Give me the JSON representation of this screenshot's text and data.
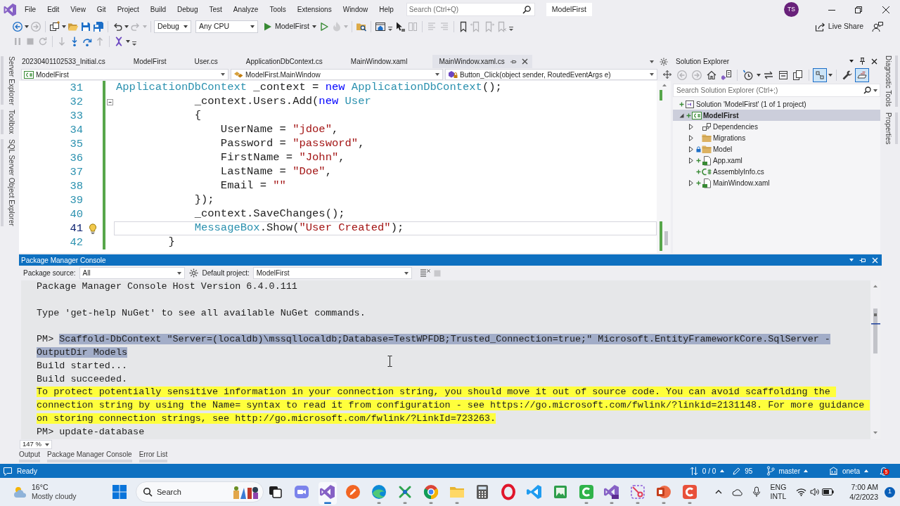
{
  "title_bar": {
    "menu": [
      "File",
      "Edit",
      "View",
      "Git",
      "Project",
      "Build",
      "Debug",
      "Test",
      "Analyze",
      "Tools",
      "Extensions",
      "Window",
      "Help"
    ],
    "search": {
      "placeholder": "Search (Ctrl+Q)"
    },
    "solution_name": "ModelFirst",
    "account_initials": "TS"
  },
  "toolbar": [
    {
      "kind": "back",
      "disabled": false
    },
    {
      "kind": "forward",
      "disabled": true
    },
    {
      "kind": "new-project",
      "disabled": false
    },
    {
      "kind": "open",
      "disabled": false
    },
    {
      "kind": "save",
      "disabled": false
    },
    {
      "kind": "save-all",
      "disabled": false
    },
    {
      "kind": "undo",
      "disabled": false
    },
    {
      "kind": "redo",
      "disabled": true
    },
    {
      "kind": "configuration",
      "value": "Debug",
      "disabled": false
    },
    {
      "kind": "platform",
      "value": "Any CPU",
      "disabled": false
    },
    {
      "kind": "start",
      "label": "ModelFirst",
      "disabled": false
    },
    {
      "kind": "start-without-debugging",
      "disabled": false
    },
    {
      "kind": "hot-reload",
      "disabled": true
    },
    {
      "kind": "find-in-folder",
      "disabled": false
    },
    {
      "kind": "browse",
      "disabled": false
    },
    {
      "kind": "overflow",
      "disabled": false
    },
    {
      "kind": "pointer",
      "disabled": false
    },
    {
      "kind": "layout",
      "disabled": true
    },
    {
      "kind": "comment",
      "disabled": true
    },
    {
      "kind": "uncomment",
      "disabled": true
    },
    {
      "kind": "bookmark",
      "disabled": false
    },
    {
      "kind": "bookmark-previous",
      "disabled": true
    },
    {
      "kind": "bookmark-next",
      "disabled": true
    },
    {
      "kind": "bookmark-clear",
      "disabled": true
    },
    {
      "kind": "overflow",
      "disabled": false
    }
  ],
  "live_share": {
    "label": "Live Share"
  },
  "debug_toolbar": [
    {
      "kind": "pause",
      "disabled": true
    },
    {
      "kind": "stop",
      "disabled": true
    },
    {
      "kind": "restart",
      "disabled": true
    },
    {
      "kind": "show-next",
      "disabled": true
    },
    {
      "kind": "step-into",
      "disabled": false
    },
    {
      "kind": "step-over",
      "disabled": false
    },
    {
      "kind": "step-out",
      "disabled": true
    },
    {
      "kind": "threads",
      "disabled": false
    },
    {
      "kind": "overflow",
      "disabled": false
    }
  ],
  "left_rail": [
    "Server Explorer",
    "Toolbox",
    "SQL Server Object Explorer"
  ],
  "right_rail": [
    "Diagnostic Tools",
    "Properties"
  ],
  "editor": {
    "tabs": [
      {
        "label": "20230401102533_Initial.cs",
        "selected": false
      },
      {
        "label": "ModelFirst",
        "selected": false
      },
      {
        "label": "User.cs",
        "selected": false
      },
      {
        "label": "ApplicationDbContext.cs",
        "selected": false
      },
      {
        "label": "MainWindow.xaml",
        "selected": false
      },
      {
        "label": "MainWindow.xaml.cs",
        "selected": true
      }
    ],
    "navigation": {
      "project": "ModelFirst",
      "type": "ModelFirst.MainWindow",
      "member": "Button_Click(object sender, RoutedEventArgs e)"
    },
    "lines": [
      {
        "number": "31",
        "current": false,
        "tokens": [
          {
            "text": "ApplicationDbContext",
            "kind": "type"
          },
          {
            "text": " _context = ",
            "kind": "plain"
          },
          {
            "text": "new",
            "kind": "keyword"
          },
          {
            "text": " ApplicationDbContext",
            "kind": "type"
          },
          {
            "text": "();",
            "kind": "plain"
          }
        ]
      },
      {
        "number": "32",
        "current": false,
        "expanded": true,
        "tokens": [
          {
            "text": "            _context.Users.Add(",
            "kind": "plain"
          },
          {
            "text": "new",
            "kind": "keyword"
          },
          {
            "text": " User",
            "kind": "type"
          }
        ]
      },
      {
        "number": "33",
        "current": false,
        "tokens": [
          {
            "text": "            {",
            "kind": "plain"
          }
        ]
      },
      {
        "number": "34",
        "current": false,
        "tokens": [
          {
            "text": "                UserName = ",
            "kind": "plain"
          },
          {
            "text": "\"jdoe\"",
            "kind": "string"
          },
          {
            "text": ",",
            "kind": "plain"
          }
        ]
      },
      {
        "number": "35",
        "current": false,
        "tokens": [
          {
            "text": "                Password = ",
            "kind": "plain"
          },
          {
            "text": "\"password\"",
            "kind": "string"
          },
          {
            "text": ",",
            "kind": "plain"
          }
        ]
      },
      {
        "number": "36",
        "current": false,
        "tokens": [
          {
            "text": "                FirstName = ",
            "kind": "plain"
          },
          {
            "text": "\"John\"",
            "kind": "string"
          },
          {
            "text": ",",
            "kind": "plain"
          }
        ]
      },
      {
        "number": "37",
        "current": false,
        "tokens": [
          {
            "text": "                LastName = ",
            "kind": "plain"
          },
          {
            "text": "\"Doe\"",
            "kind": "string"
          },
          {
            "text": ",",
            "kind": "plain"
          }
        ]
      },
      {
        "number": "38",
        "current": false,
        "tokens": [
          {
            "text": "                Email = ",
            "kind": "plain"
          },
          {
            "text": "\"\"",
            "kind": "string"
          }
        ]
      },
      {
        "number": "39",
        "current": false,
        "tokens": [
          {
            "text": "            });",
            "kind": "plain"
          }
        ]
      },
      {
        "number": "40",
        "current": false,
        "tokens": [
          {
            "text": "            _context.SaveChanges();",
            "kind": "plain"
          }
        ]
      },
      {
        "number": "41",
        "current": true,
        "tokens": [
          {
            "text": "            MessageBox",
            "kind": "type"
          },
          {
            "text": ".Show(",
            "kind": "plain"
          },
          {
            "text": "\"User Created\"",
            "kind": "string"
          },
          {
            "text": ");",
            "kind": "plain"
          }
        ]
      },
      {
        "number": "42",
        "current": false,
        "tokens": [
          {
            "text": "        }",
            "kind": "plain"
          }
        ]
      }
    ]
  },
  "solution_explorer": {
    "title": "Solution Explorer",
    "toolbar": [
      {
        "kind": "back",
        "disabled": true,
        "on": false
      },
      {
        "kind": "forward",
        "disabled": true,
        "on": false
      },
      {
        "kind": "home",
        "disabled": false,
        "on": false
      },
      {
        "kind": "switch-views",
        "disabled": false,
        "on": false
      },
      {
        "kind": "history",
        "disabled": false,
        "on": false
      },
      {
        "kind": "sync",
        "disabled": false,
        "on": false
      },
      {
        "kind": "collapse",
        "disabled": false,
        "on": false
      },
      {
        "kind": "show-all",
        "disabled": false,
        "on": false
      },
      {
        "kind": "filter",
        "disabled": false,
        "on": true
      },
      {
        "kind": "properties",
        "disabled": false,
        "on": false
      },
      {
        "kind": "preview",
        "disabled": false,
        "on": true
      }
    ],
    "search": {
      "placeholder": "Search Solution Explorer (Ctrl+;)"
    },
    "tree": [
      {
        "label": "Solution 'ModelFirst' (1 of 1 project)",
        "kind": "solution",
        "added": true,
        "checked_in": false,
        "selected": false,
        "children": [
          {
            "label": "ModelFirst",
            "kind": "project",
            "added": true,
            "checked_in": false,
            "selected": true,
            "startup": true,
            "expanded": true,
            "children": [
              {
                "label": "Dependencies",
                "kind": "dependencies",
                "added": false,
                "checked_in": false,
                "selected": false,
                "expanded": false
              },
              {
                "label": "Migrations",
                "kind": "folder",
                "added": false,
                "checked_in": false,
                "selected": false,
                "expanded": false
              },
              {
                "label": "Model",
                "kind": "folder",
                "added": false,
                "checked_in": true,
                "selected": false,
                "expanded": false
              },
              {
                "label": "App.xaml",
                "kind": "xaml",
                "added": true,
                "checked_in": false,
                "selected": false,
                "expanded": false
              },
              {
                "label": "AssemblyInfo.cs",
                "kind": "csharp",
                "added": true,
                "checked_in": false,
                "selected": false
              },
              {
                "label": "MainWindow.xaml",
                "kind": "xaml",
                "added": true,
                "checked_in": false,
                "selected": false,
                "expanded": false
              }
            ]
          }
        ]
      }
    ]
  },
  "package_manager_console": {
    "title": "Package Manager Console",
    "package_source_label": "Package source:",
    "package_source": "All",
    "default_project_label": "Default project:",
    "default_project": "ModelFirst",
    "output": [
      {
        "kind": "text",
        "text": "Package Manager Console Host Version 6.4.0.111"
      },
      {
        "kind": "blank"
      },
      {
        "kind": "text",
        "text": "Type 'get-help NuGet' to see all available NuGet commands."
      },
      {
        "kind": "blank"
      },
      {
        "kind": "command",
        "prompt": "PM>",
        "text": "Scaffold-DbContext \"Server=(localdb)\\mssqllocaldb;Database=TestWPFDB;Trusted_Connection=true;\" Microsoft.EntityFrameworkCore.SqlServer -OutputDir Models",
        "selected": true
      },
      {
        "kind": "text",
        "text": "Build started..."
      },
      {
        "kind": "text",
        "text": "Build succeeded."
      },
      {
        "kind": "warning",
        "text": "To protect potentially sensitive information in your connection string, you should move it out of source code. You can avoid scaffolding the connection string by using the Name= syntax to read it from configuration - see https://go.microsoft.com/fwlink/?linkid=2131148. For more guidance on storing connection strings, see http://go.microsoft.com/fwlink/?LinkId=723263."
      },
      {
        "kind": "command",
        "prompt": "PM>",
        "text": "update-database",
        "selected": false
      }
    ],
    "zoom": "147 %"
  },
  "tool_tabs": [
    "Output",
    "Package Manager Console",
    "Error List"
  ],
  "status_bar": {
    "message": "Ready",
    "changes": "0 / 0",
    "edits": "95",
    "branch": "master",
    "repository": "oneta",
    "notifications": "5"
  },
  "taskbar": {
    "weather": {
      "temperature": "16°C",
      "condition": "Mostly cloudy"
    },
    "search": {
      "placeholder": "Search"
    },
    "apps": [
      {
        "kind": "taskview",
        "running": false,
        "active": false
      },
      {
        "kind": "chat",
        "running": false,
        "active": false
      },
      {
        "kind": "ide",
        "running": true,
        "active": true
      },
      {
        "kind": "sketch",
        "running": false,
        "active": false
      },
      {
        "kind": "browser",
        "running": true,
        "active": false
      },
      {
        "kind": "tool",
        "running": true,
        "active": false
      },
      {
        "kind": "globe",
        "running": true,
        "active": false
      },
      {
        "kind": "folder",
        "running": true,
        "active": false
      },
      {
        "kind": "calculator",
        "running": false,
        "active": false
      },
      {
        "kind": "ring",
        "running": false,
        "active": false
      },
      {
        "kind": "editor",
        "running": false,
        "active": false
      },
      {
        "kind": "photo",
        "running": false,
        "active": false
      },
      {
        "kind": "capture",
        "running": true,
        "active": false
      },
      {
        "kind": "preview",
        "running": true,
        "active": false
      },
      {
        "kind": "snip",
        "running": true,
        "active": false
      },
      {
        "kind": "slides",
        "running": true,
        "active": false
      },
      {
        "kind": "clip",
        "running": true,
        "active": false
      }
    ],
    "language": {
      "input": "ENG",
      "layout": "INTL"
    },
    "clock": {
      "time": "7:00 AM",
      "date": "4/2/2023"
    },
    "notifications": "1"
  }
}
